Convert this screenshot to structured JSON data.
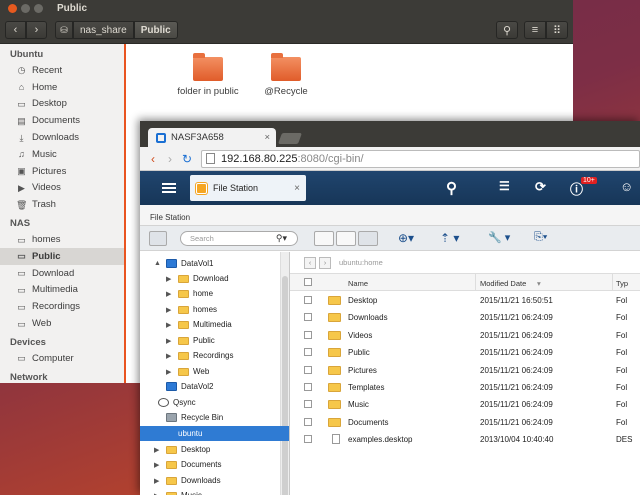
{
  "nautilus": {
    "title": "Public",
    "breadcrumbs": [
      "nas_share",
      "Public"
    ],
    "sidebar": [
      {
        "type": "head",
        "label": "Ubuntu"
      },
      {
        "type": "item",
        "label": "Recent",
        "icon": "clock-icon"
      },
      {
        "type": "item",
        "label": "Home",
        "icon": "home-icon"
      },
      {
        "type": "item",
        "label": "Desktop",
        "icon": "folder-icon"
      },
      {
        "type": "item",
        "label": "Documents",
        "icon": "document-icon"
      },
      {
        "type": "item",
        "label": "Downloads",
        "icon": "download-icon"
      },
      {
        "type": "item",
        "label": "Music",
        "icon": "music-icon"
      },
      {
        "type": "item",
        "label": "Pictures",
        "icon": "picture-icon"
      },
      {
        "type": "item",
        "label": "Videos",
        "icon": "video-icon"
      },
      {
        "type": "item",
        "label": "Trash",
        "icon": "trash-icon"
      },
      {
        "type": "head",
        "label": "NAS"
      },
      {
        "type": "item",
        "label": "homes",
        "icon": "folder-icon"
      },
      {
        "type": "item",
        "label": "Public",
        "icon": "folder-icon",
        "active": true
      },
      {
        "type": "item",
        "label": "Download",
        "icon": "folder-icon"
      },
      {
        "type": "item",
        "label": "Multimedia",
        "icon": "folder-icon"
      },
      {
        "type": "item",
        "label": "Recordings",
        "icon": "folder-icon"
      },
      {
        "type": "item",
        "label": "Web",
        "icon": "folder-icon"
      },
      {
        "type": "head",
        "label": "Devices"
      },
      {
        "type": "item",
        "label": "Computer",
        "icon": "computer-icon"
      },
      {
        "type": "head",
        "label": "Network"
      }
    ],
    "files": [
      "folder in public",
      "@Recycle"
    ]
  },
  "browser": {
    "tab_title": "NASF3A658",
    "url_host": "192.168.80.225",
    "url_rest": ":8080/cgi-bin/"
  },
  "filestation": {
    "tab_label": "File Station",
    "panel_label": "File Station",
    "search_placeholder": "Search",
    "notification_count": "10+",
    "path": "ubuntu:home",
    "tree": [
      {
        "label": "DataVol1",
        "level": 0,
        "kind": "vol",
        "arrow": "▲"
      },
      {
        "label": "Download",
        "level": 1,
        "kind": "folder",
        "arrow": "▶"
      },
      {
        "label": "home",
        "level": 1,
        "kind": "folder",
        "arrow": "▶"
      },
      {
        "label": "homes",
        "level": 1,
        "kind": "folder",
        "arrow": "▶"
      },
      {
        "label": "Multimedia",
        "level": 1,
        "kind": "folder",
        "arrow": "▶"
      },
      {
        "label": "Public",
        "level": 1,
        "kind": "folder",
        "arrow": "▶"
      },
      {
        "label": "Recordings",
        "level": 1,
        "kind": "folder",
        "arrow": "▶"
      },
      {
        "label": "Web",
        "level": 1,
        "kind": "folder",
        "arrow": "▶"
      },
      {
        "label": "DataVol2",
        "level": 0,
        "kind": "vol",
        "arrow": ""
      },
      {
        "label": "Qsync",
        "level": -1,
        "kind": "sync",
        "arrow": ""
      },
      {
        "label": "Recycle Bin",
        "level": 0,
        "kind": "bin",
        "arrow": ""
      },
      {
        "label": "ubuntu",
        "level": -1,
        "kind": "none",
        "arrow": "",
        "selected": true
      },
      {
        "label": "Desktop",
        "level": 0,
        "kind": "folder",
        "arrow": "▶"
      },
      {
        "label": "Documents",
        "level": 0,
        "kind": "folder",
        "arrow": "▶"
      },
      {
        "label": "Downloads",
        "level": 0,
        "kind": "folder",
        "arrow": "▶"
      },
      {
        "label": "Music",
        "level": 0,
        "kind": "folder",
        "arrow": "▶"
      }
    ],
    "columns": {
      "name": "Name",
      "modified": "Modified Date",
      "type": "Typ"
    },
    "rows": [
      {
        "name": "Desktop",
        "modified": "2015/11/21 16:50:51",
        "type": "Fol",
        "kind": "folder"
      },
      {
        "name": "Downloads",
        "modified": "2015/11/21 06:24:09",
        "type": "Fol",
        "kind": "folder"
      },
      {
        "name": "Videos",
        "modified": "2015/11/21 06:24:09",
        "type": "Fol",
        "kind": "folder"
      },
      {
        "name": "Public",
        "modified": "2015/11/21 06:24:09",
        "type": "Fol",
        "kind": "folder"
      },
      {
        "name": "Pictures",
        "modified": "2015/11/21 06:24:09",
        "type": "Fol",
        "kind": "folder"
      },
      {
        "name": "Templates",
        "modified": "2015/11/21 06:24:09",
        "type": "Fol",
        "kind": "folder"
      },
      {
        "name": "Music",
        "modified": "2015/11/21 06:24:09",
        "type": "Fol",
        "kind": "folder"
      },
      {
        "name": "Documents",
        "modified": "2015/11/21 06:24:09",
        "type": "Fol",
        "kind": "folder"
      },
      {
        "name": "examples.desktop",
        "modified": "2013/10/04 10:40:40",
        "type": "DES",
        "kind": "file"
      }
    ]
  },
  "colors": {
    "ubuntu_orange": "#e95420",
    "qnap_blue": "#1b3d63",
    "selection": "#2f7bd3"
  }
}
